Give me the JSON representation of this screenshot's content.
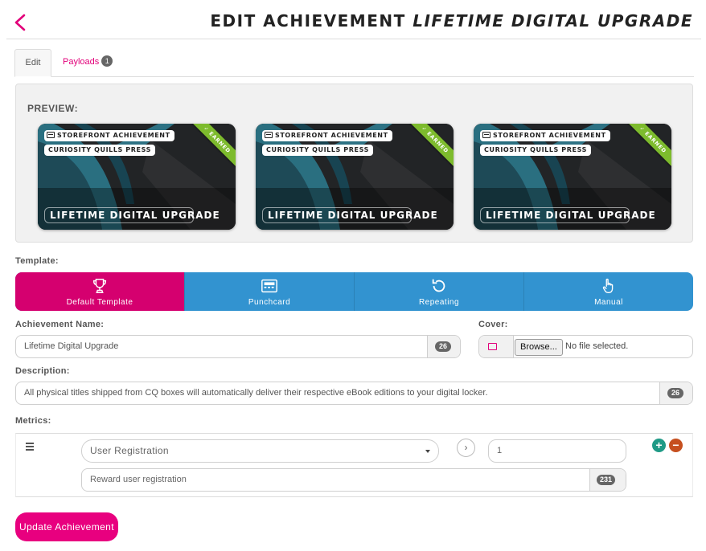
{
  "header": {
    "title_prefix": "EDIT ACHIEVEMENT",
    "title_name": "LIFETIME DIGITAL UPGRADE"
  },
  "tabs": [
    {
      "label": "Edit",
      "active": true
    },
    {
      "label": "Payloads",
      "badge": "1",
      "active": false
    }
  ],
  "preview": {
    "label": "PREVIEW:",
    "cards": [
      {
        "type": "STOREFRONT ACHIEVEMENT",
        "org": "CURIOSITY QUILLS PRESS",
        "name": "LIFETIME DIGITAL UPGRADE",
        "ribbon": "EARNED"
      },
      {
        "type": "STOREFRONT ACHIEVEMENT",
        "org": "CURIOSITY QUILLS PRESS",
        "name": "LIFETIME DIGITAL UPGRADE",
        "ribbon": "EARNED"
      },
      {
        "type": "STOREFRONT ACHIEVEMENT",
        "org": "CURIOSITY QUILLS PRESS",
        "name": "LIFETIME DIGITAL UPGRADE",
        "ribbon": "EARNED"
      }
    ]
  },
  "template": {
    "label": "Template:",
    "options": [
      {
        "label": "Default Template",
        "icon": "trophy-icon",
        "active": true
      },
      {
        "label": "Punchcard",
        "icon": "card-icon",
        "active": false
      },
      {
        "label": "Repeating",
        "icon": "repeat-icon",
        "active": false
      },
      {
        "label": "Manual",
        "icon": "hand-pointer-icon",
        "active": false
      }
    ]
  },
  "achievement_name": {
    "label": "Achievement Name:",
    "value": "Lifetime Digital Upgrade",
    "count": "26"
  },
  "cover": {
    "label": "Cover:",
    "browse": "Browse...",
    "file_status": "No file selected."
  },
  "description": {
    "label": "Description:",
    "value": "All physical titles shipped from CQ boxes will automatically deliver their respective eBook editions to your digital locker.",
    "count": "26"
  },
  "metrics": {
    "label": "Metrics:",
    "rows": [
      {
        "metric": "User Registration",
        "threshold": "1",
        "reward": "Reward user registration",
        "reward_count": "231"
      }
    ]
  },
  "actions": {
    "submit": "Update Achievement"
  },
  "colors": {
    "accent": "#e2007a",
    "template_bar": "#3293d0",
    "template_active": "#d5006f",
    "ribbon": "#7dbb2d",
    "add": "#1f9a86",
    "remove": "#c6501f"
  }
}
